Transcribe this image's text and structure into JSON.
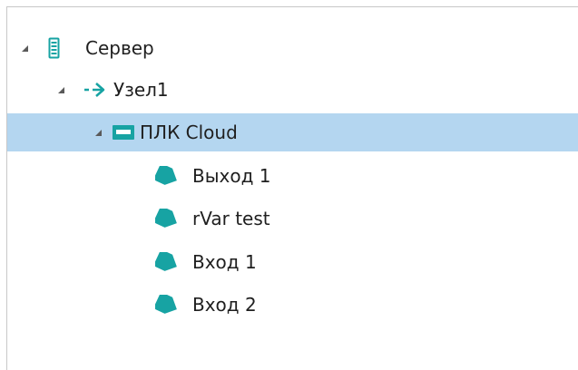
{
  "colors": {
    "teal": "#17a3a3",
    "selection": "#b4d6f0",
    "expander": "#5a5a5a"
  },
  "tree": {
    "root": {
      "label": "Сервер",
      "icon": "server-icon",
      "expanded": true
    },
    "node": {
      "label": "Узел1",
      "icon": "arrow-right-icon",
      "expanded": true
    },
    "device": {
      "label": "ПЛК Cloud",
      "icon": "plc-device-icon",
      "expanded": true,
      "selected": true
    },
    "tags": [
      {
        "label": "Выход 1",
        "icon": "tag-icon"
      },
      {
        "label": "rVar test",
        "icon": "tag-icon"
      },
      {
        "label": "Вход 1",
        "icon": "tag-icon"
      },
      {
        "label": "Вход 2",
        "icon": "tag-icon"
      }
    ]
  }
}
